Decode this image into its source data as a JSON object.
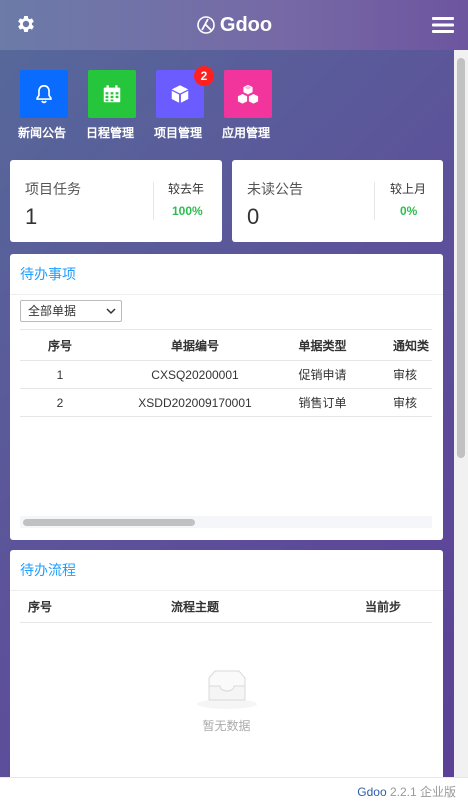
{
  "header": {
    "brand": "Gdoo",
    "settings_icon": "gear-icon",
    "menu_icon": "hamburger-menu-icon"
  },
  "apps": [
    {
      "label": "新闻公告",
      "icon": "bell-icon",
      "color": "#0a6cff",
      "badge": ""
    },
    {
      "label": "日程管理",
      "icon": "calendar-icon",
      "color": "#25c63b",
      "badge": ""
    },
    {
      "label": "项目管理",
      "icon": "cube-icon",
      "color": "#6a5cff",
      "badge": "2"
    },
    {
      "label": "应用管理",
      "icon": "cubes-icon",
      "color": "#f2359d",
      "badge": ""
    }
  ],
  "stats": [
    {
      "title": "项目任务",
      "value": "1",
      "compare_label": "较去年",
      "percent": "100%"
    },
    {
      "title": "未读公告",
      "value": "0",
      "compare_label": "较上月",
      "percent": "0%"
    }
  ],
  "todo": {
    "title": "待办事项",
    "filter_value": "全部单据",
    "columns": [
      "序号",
      "单据编号",
      "单据类型",
      "通知类"
    ],
    "rows": [
      [
        "1",
        "CXSQ20200001",
        "促销申请",
        "审核"
      ],
      [
        "2",
        "XSDD202009170001",
        "销售订单",
        "审核"
      ]
    ]
  },
  "flow": {
    "title": "待办流程",
    "columns": [
      "序号",
      "流程主题",
      "当前步"
    ],
    "empty_text": "暂无数据"
  },
  "footer": {
    "brand": "Gdoo",
    "version": "2.2.1 企业版"
  },
  "colors": {
    "accent": "#1e9fff",
    "success": "#2cbe4e",
    "badge": "#ff2020"
  }
}
